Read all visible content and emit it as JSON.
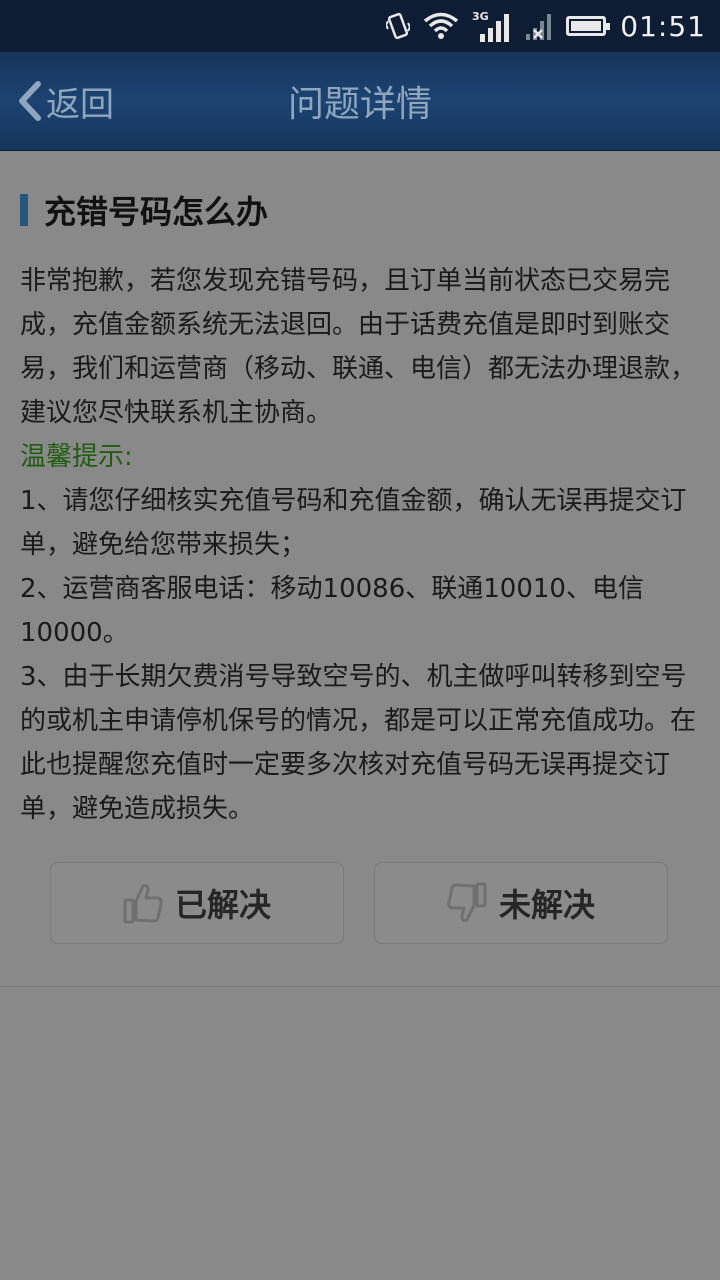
{
  "status_bar": {
    "time": "01:51",
    "network_type": "3G",
    "icons": [
      "vibrate-icon",
      "wifi-icon",
      "signal-icon",
      "no-signal-icon",
      "battery-icon"
    ]
  },
  "header": {
    "back_label": "返回",
    "title": "问题详情"
  },
  "question": {
    "title": "充错号码怎么办"
  },
  "answer": {
    "intro": "非常抱歉，若您发现充错号码，且订单当前状态已交易完成，充值金额系统无法退回。由于话费充值是即时到账交易，我们和运营商（移动、联通、电信）都无法办理退款，建议您尽快联系机主协商。",
    "tip_title": "温馨提示:",
    "tips": [
      "1、请您仔细核实充值号码和充值金额，确认无误再提交订单，避免给您带来损失；",
      "2、运营商客服电话：移动10086、联通10010、电信10000。",
      "3、由于长期欠费消号导致空号的、机主做呼叫转移到空号的或机主申请停机保号的情况，都是可以正常充值成功。在此也提醒您充值时一定要多次核对充值号码无误再提交订单，避免造成损失。"
    ]
  },
  "feedback": {
    "solved_label": "已解决",
    "unsolved_label": "未解决"
  },
  "colors": {
    "header_bg": "#1d4372",
    "header_text": "#8fa6bf",
    "page_bg": "#898989",
    "title_accent": "#23587e",
    "tip_green": "#1f5e10"
  }
}
